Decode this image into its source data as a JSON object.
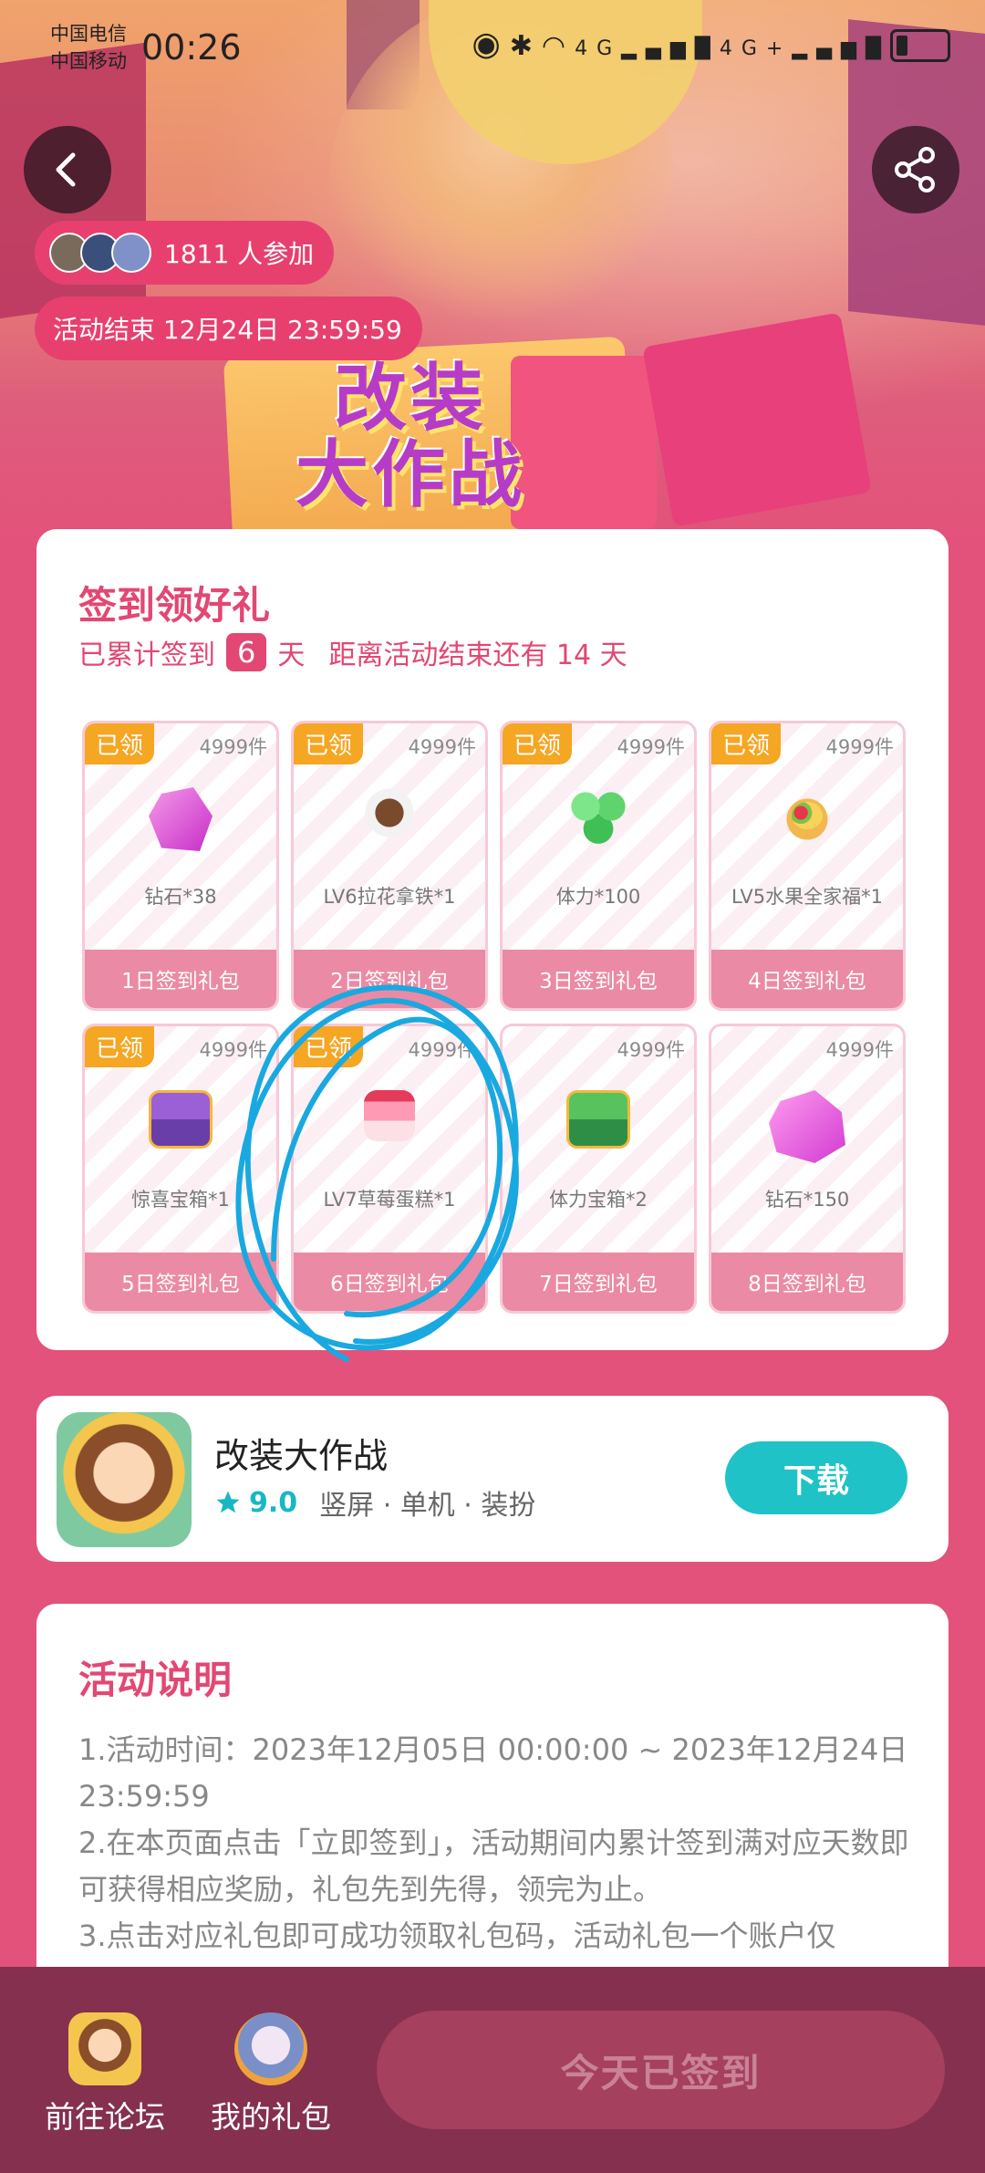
{
  "status_bar": {
    "carrier_1": "中国电信",
    "carrier_2": "中国移动",
    "time": "00:26",
    "icons": [
      "eye-icon",
      "bluetooth-icon",
      "wifi-icon",
      "signal-4g-icon",
      "signal-4g-icon",
      "battery-icon"
    ],
    "net_1": "4G",
    "net_2": "4G+"
  },
  "hero": {
    "participants": "1811 人参加",
    "end_time": "活动结束 12月24日 23:59:59",
    "game_logo_line1": "改装",
    "game_logo_line2": "大作战"
  },
  "signin": {
    "title": "签到领好礼",
    "prefix": "已累计签到",
    "days": "6",
    "suffix": "天",
    "remaining": "距离活动结束还有 14 天",
    "gifts": [
      {
        "badge": "已领",
        "qty": "4999件",
        "name": "钻石*38",
        "day": "1日签到礼包",
        "claimed": true,
        "icon": "gem-icon"
      },
      {
        "badge": "已领",
        "qty": "4999件",
        "name": "LV6拉花拿铁*1",
        "day": "2日签到礼包",
        "claimed": true,
        "icon": "coffee-icon"
      },
      {
        "badge": "已领",
        "qty": "4999件",
        "name": "体力*100",
        "day": "3日签到礼包",
        "claimed": true,
        "icon": "clover-icon"
      },
      {
        "badge": "已领",
        "qty": "4999件",
        "name": "LV5水果全家福*1",
        "day": "4日签到礼包",
        "claimed": true,
        "icon": "fruit-tart-icon"
      },
      {
        "badge": "已领",
        "qty": "4999件",
        "name": "惊喜宝箱*1",
        "day": "5日签到礼包",
        "claimed": true,
        "icon": "chest-icon"
      },
      {
        "badge": "已领",
        "qty": "4999件",
        "name": "LV7草莓蛋糕*1",
        "day": "6日签到礼包",
        "claimed": true,
        "icon": "cake-icon"
      },
      {
        "badge": "",
        "qty": "4999件",
        "name": "体力宝箱*2",
        "day": "7日签到礼包",
        "claimed": false,
        "icon": "green-chest-icon"
      },
      {
        "badge": "",
        "qty": "4999件",
        "name": "钻石*150",
        "day": "8日签到礼包",
        "claimed": false,
        "icon": "gem-icon"
      }
    ]
  },
  "app": {
    "name": "改装大作战",
    "rating": "9.0",
    "tags": "竖屏 · 单机 · 装扮",
    "download_label": "下载"
  },
  "description": {
    "title": "活动说明",
    "lines": [
      "1.活动时间：2023年12月05日 00:00:00 ~ 2023年12月24日 23:59:59",
      "2.在本页面点击「立即签到」，活动期间内累计签到满对应天数即可获得相应奖励，礼包先到先得，领完为止。",
      "3.点击对应礼包即可成功领取礼包码，活动礼包一个账户仅"
    ]
  },
  "bottom_nav": {
    "forum_label": "前往论坛",
    "gifts_label": "我的礼包",
    "signed_label": "今天已签到"
  },
  "colors": {
    "primary": "#e34773",
    "badge": "#f5a623",
    "download": "#1fc2c7",
    "bottom_bar": "#84304e",
    "annotation": "#19a9e0"
  }
}
